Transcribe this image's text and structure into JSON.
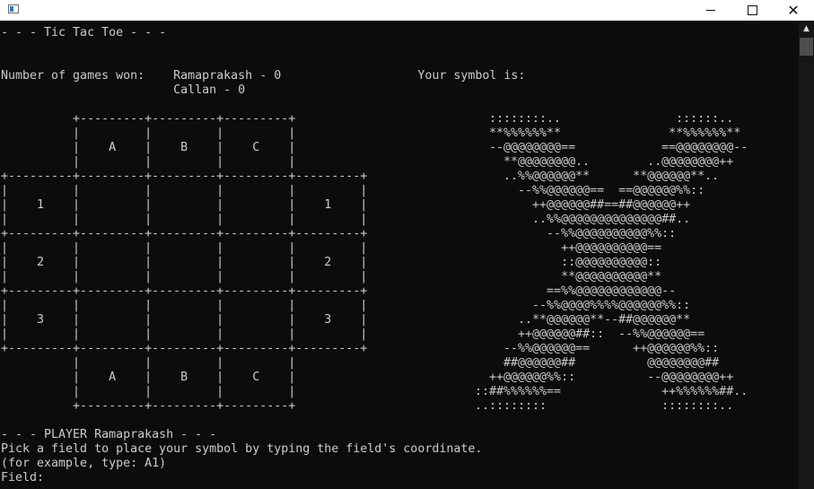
{
  "window": {
    "title": "",
    "minimize_label": "",
    "close_label": "✕"
  },
  "console": {
    "header": "- - - Tic Tac Toe - - -",
    "scoreboard": "Number of games won:    Ramaprakash - 0                   Your symbol is:\n                        Callan - 0",
    "board": "          +---------+---------+---------+\n          |         |         |         |\n          |    A    |    B    |    C    |\n          |         |         |         |\n+---------+---------+---------+---------+---------+\n|         |         |         |         |         |\n|    1    |         |         |         |    1    |\n|         |         |         |         |         |\n+---------+---------+---------+---------+---------+\n|         |         |         |         |         |\n|    2    |         |         |         |    2    |\n|         |         |         |         |         |\n+---------+---------+---------+---------+---------+\n|         |         |         |         |         |\n|    3    |         |         |         |    3    |\n|         |         |         |         |         |\n+---------+---------+---------+---------+---------+\n          |         |         |         |\n          |    A    |    B    |    C    |\n          |         |         |         |\n          +---------+---------+---------+",
    "symbol_art": "  ::::::::..                ::::::..\n  **%%%%%%**               **%%%%%%**\n  --@@@@@@@@==            ==@@@@@@@@--\n    **@@@@@@@@..        ..@@@@@@@@++\n    ..%%@@@@@@**      **@@@@@@**..\n      --%%@@@@@@==  ==@@@@@@%%::\n        ++@@@@@@##==##@@@@@@++\n        ..%%@@@@@@@@@@@@@@##..\n          --%%@@@@@@@@@@%%::\n            ++@@@@@@@@@@==\n            ::@@@@@@@@@@::\n            **@@@@@@@@@@**\n          ==%%@@@@@@@@@@@@--\n        --%%@@@@%%%%@@@@@@%%::\n      ..**@@@@@@**--##@@@@@@**\n      ++@@@@@@##::  --%%@@@@@@==\n    --%%@@@@@@==      ++@@@@@@%%::\n    ##@@@@@@##          @@@@@@@@##\n  ++@@@@@@%%::          --@@@@@@@@++\n::##%%%%%%==              ++%%%%%%##..\n..::::::::                ::::::::..",
    "prompt": "- - - PLAYER Ramaprakash - - -\nPick a field to place your symbol by typing the field's coordinate.\n(for example, type: A1)\nField:"
  },
  "scrollbar": {
    "up_arrow": "▲"
  }
}
